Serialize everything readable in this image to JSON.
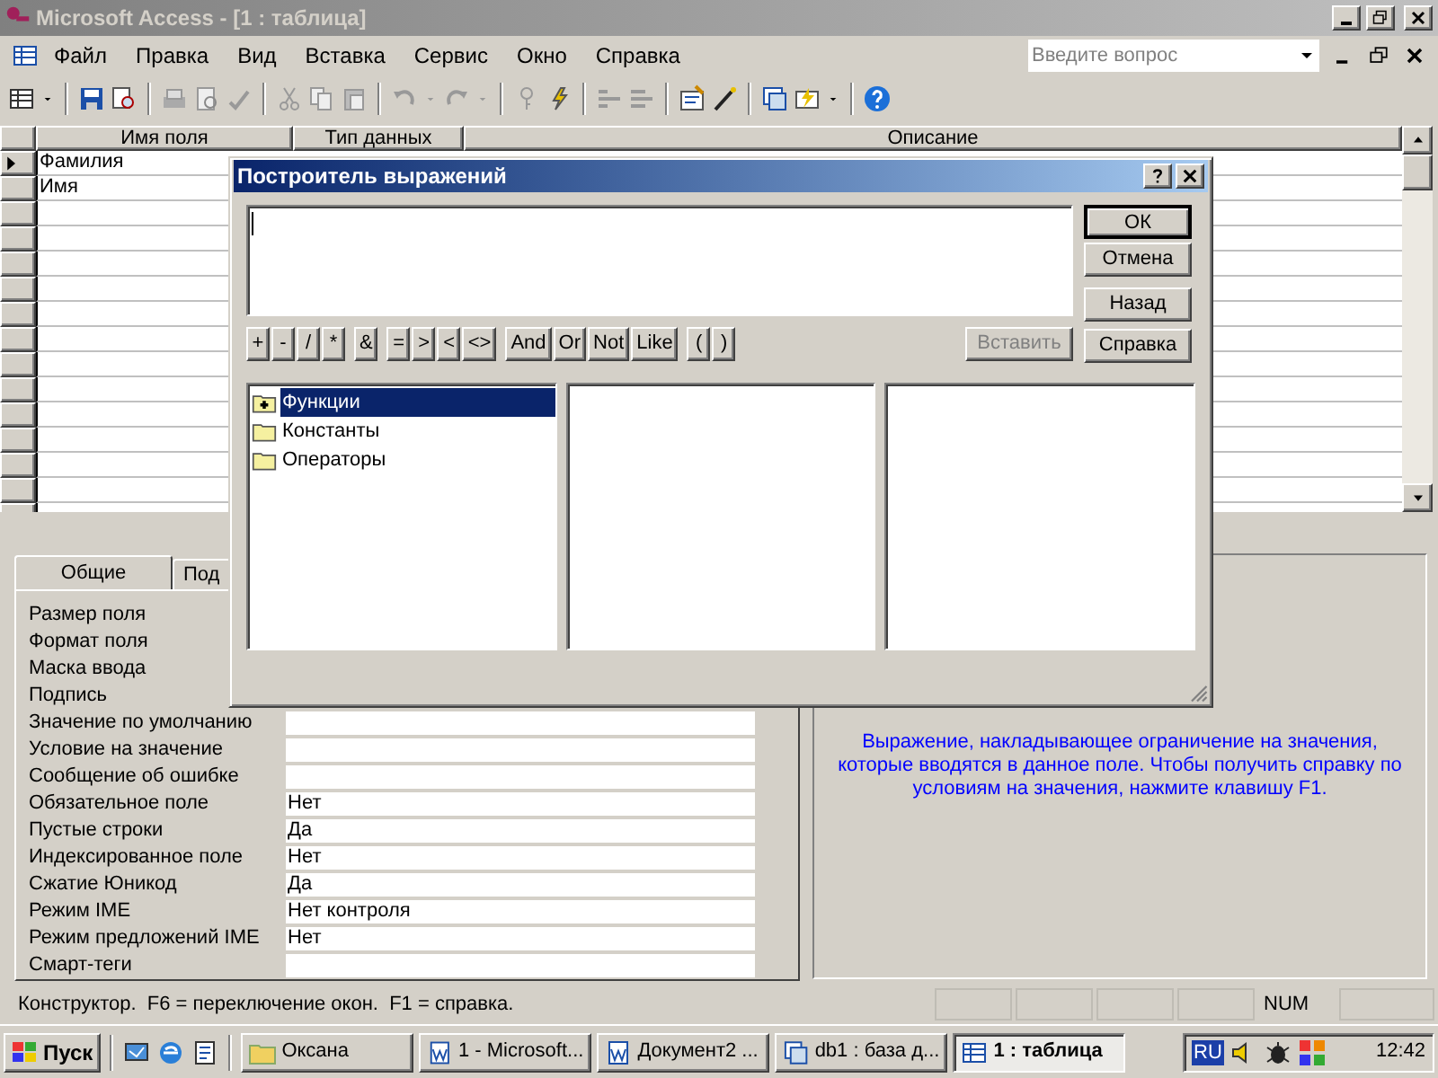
{
  "app_window": {
    "title": "Microsoft Access - [1 : таблица]"
  },
  "menu": [
    "Файл",
    "Правка",
    "Вид",
    "Вставка",
    "Сервис",
    "Окно",
    "Справка"
  ],
  "help_search": {
    "placeholder": "Введите вопрос"
  },
  "table": {
    "columns": [
      "Имя поля",
      "Тип данных",
      "Описание"
    ],
    "rows": [
      {
        "field_name": "Фамилия",
        "current": true
      },
      {
        "field_name": "Имя",
        "current": false
      }
    ]
  },
  "dialog": {
    "title": "Построитель выражений",
    "side_buttons": [
      [
        {
          "label": "ОК",
          "default": true
        },
        {
          "label": "Отмена",
          "default": false
        }
      ],
      [
        {
          "label": "Назад",
          "default": false
        }
      ]
    ],
    "help_button": "Справка",
    "operators": [
      [
        "+",
        "-",
        "/",
        "*"
      ],
      [
        "&"
      ],
      [
        "=",
        ">",
        "<",
        "<>"
      ],
      [
        "And",
        "Or",
        "Not",
        "Like"
      ],
      [
        "(",
        ")"
      ]
    ],
    "paste_button": {
      "label": "Вставить",
      "disabled": true
    },
    "tree": [
      {
        "label": "Функции",
        "selected": true,
        "expandable": true
      },
      {
        "label": "Константы",
        "selected": false,
        "expandable": false
      },
      {
        "label": "Операторы",
        "selected": false,
        "expandable": false
      }
    ]
  },
  "properties": {
    "tabs": [
      {
        "label": "Общие",
        "selected": true
      },
      {
        "label": "Под",
        "selected": false
      }
    ],
    "rows": [
      {
        "label": "Размер поля"
      },
      {
        "label": "Формат поля"
      },
      {
        "label": "Маска ввода"
      },
      {
        "label": "Подпись"
      },
      {
        "label": "Значение по умолчанию"
      },
      {
        "label": "Условие на значение"
      },
      {
        "label": "Сообщение об ошибке"
      },
      {
        "label": "Обязательное поле",
        "value": "Нет"
      },
      {
        "label": "Пустые строки",
        "value": "Да"
      },
      {
        "label": "Индексированное поле",
        "value": "Нет"
      },
      {
        "label": "Сжатие Юникод",
        "value": "Да"
      },
      {
        "label": "Режим IME",
        "value": "Нет контроля"
      },
      {
        "label": "Режим предложений IME",
        "value": "Нет"
      },
      {
        "label": "Смарт-теги"
      }
    ]
  },
  "hint": "Выражение, накладывающее ограничение на значения, которые вводятся в данное поле.  Чтобы получить справку по условиям на значения, нажмите клавишу F1.",
  "status_bar": {
    "text": "Конструктор.  F6 = переключение окон.  F1 = справка.",
    "indicator": "NUM"
  },
  "taskbar": {
    "start": "Пуск",
    "tasks": [
      {
        "label": "Оксана",
        "kind": "folder",
        "selected": false
      },
      {
        "label": "1 - Microsoft...",
        "kind": "word",
        "selected": false
      },
      {
        "label": "Документ2 ...",
        "kind": "word",
        "selected": false
      },
      {
        "label": "db1 : база д...",
        "kind": "database",
        "selected": false
      },
      {
        "label": "1 : таблица",
        "kind": "table",
        "selected": true
      }
    ],
    "language": "RU",
    "clock": "12:42"
  }
}
